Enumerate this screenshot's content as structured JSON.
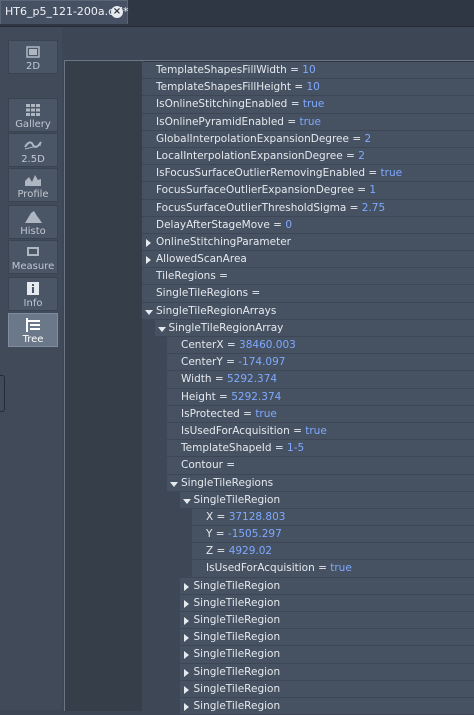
{
  "tab": {
    "title": "HT6_p5_121-200a.czi*"
  },
  "sidebar": {
    "items": [
      {
        "id": "2d",
        "label": "2D",
        "icon": "image-icon",
        "active": false
      },
      {
        "id": "gallery",
        "label": "Gallery",
        "icon": "grid-icon",
        "active": false
      },
      {
        "id": "25d",
        "label": "2.5D",
        "icon": "surface-icon",
        "active": false
      },
      {
        "id": "profile",
        "label": "Profile",
        "icon": "profile-chart-icon",
        "active": false
      },
      {
        "id": "histo",
        "label": "Histo",
        "icon": "histogram-icon",
        "active": false
      },
      {
        "id": "measure",
        "label": "Measure",
        "icon": "measure-icon",
        "active": false
      },
      {
        "id": "info",
        "label": "Info",
        "icon": "info-icon",
        "active": false
      },
      {
        "id": "tree",
        "label": "Tree",
        "icon": "tree-icon",
        "active": true
      }
    ]
  },
  "tree": {
    "rows": [
      {
        "level": 0,
        "toggle": "none",
        "key": "TemplateShapesFillWidth",
        "value": "10"
      },
      {
        "level": 0,
        "toggle": "none",
        "key": "TemplateShapesFillHeight",
        "value": "10"
      },
      {
        "level": 0,
        "toggle": "none",
        "key": "IsOnlineStitchingEnabled",
        "value": "true"
      },
      {
        "level": 0,
        "toggle": "none",
        "key": "IsOnlinePyramidEnabled",
        "value": "true"
      },
      {
        "level": 0,
        "toggle": "none",
        "key": "GlobalInterpolationExpansionDegree",
        "value": "2"
      },
      {
        "level": 0,
        "toggle": "none",
        "key": "LocalInterpolationExpansionDegree",
        "value": "2"
      },
      {
        "level": 0,
        "toggle": "none",
        "key": "IsFocusSurfaceOutlierRemovingEnabled",
        "value": "true"
      },
      {
        "level": 0,
        "toggle": "none",
        "key": "FocusSurfaceOutlierExpansionDegree",
        "value": "1"
      },
      {
        "level": 0,
        "toggle": "none",
        "key": "FocusSurfaceOutlierThresholdSigma",
        "value": "2.75"
      },
      {
        "level": 0,
        "toggle": "none",
        "key": "DelayAfterStageMove",
        "value": "0"
      },
      {
        "level": 0,
        "toggle": "closed",
        "key": "OnlineStitchingParameter",
        "value": null
      },
      {
        "level": 0,
        "toggle": "closed",
        "key": "AllowedScanArea",
        "value": null
      },
      {
        "level": 0,
        "toggle": "none",
        "key": "TileRegions",
        "value": ""
      },
      {
        "level": 0,
        "toggle": "none",
        "key": "SingleTileRegions",
        "value": ""
      },
      {
        "level": 0,
        "toggle": "open",
        "key": "SingleTileRegionArrays",
        "value": null
      },
      {
        "level": 1,
        "toggle": "open",
        "key": "SingleTileRegionArray",
        "value": null
      },
      {
        "level": 2,
        "toggle": "none",
        "key": "CenterX",
        "value": "38460.003"
      },
      {
        "level": 2,
        "toggle": "none",
        "key": "CenterY",
        "value": "-174.097"
      },
      {
        "level": 2,
        "toggle": "none",
        "key": "Width",
        "value": "5292.374"
      },
      {
        "level": 2,
        "toggle": "none",
        "key": "Height",
        "value": "5292.374"
      },
      {
        "level": 2,
        "toggle": "none",
        "key": "IsProtected",
        "value": "true"
      },
      {
        "level": 2,
        "toggle": "none",
        "key": "IsUsedForAcquisition",
        "value": "true"
      },
      {
        "level": 2,
        "toggle": "none",
        "key": "TemplateShapeId",
        "value": "1-5"
      },
      {
        "level": 2,
        "toggle": "none",
        "key": "Contour",
        "value": ""
      },
      {
        "level": 2,
        "toggle": "open",
        "key": "SingleTileRegions",
        "value": null
      },
      {
        "level": 3,
        "toggle": "open",
        "key": "SingleTileRegion",
        "value": null
      },
      {
        "level": 4,
        "toggle": "none",
        "key": "X",
        "value": "37128.803"
      },
      {
        "level": 4,
        "toggle": "none",
        "key": "Y",
        "value": "-1505.297"
      },
      {
        "level": 4,
        "toggle": "none",
        "key": "Z",
        "value": "4929.02"
      },
      {
        "level": 4,
        "toggle": "none",
        "key": "IsUsedForAcquisition",
        "value": "true"
      },
      {
        "level": 3,
        "toggle": "closed",
        "key": "SingleTileRegion",
        "value": null
      },
      {
        "level": 3,
        "toggle": "closed",
        "key": "SingleTileRegion",
        "value": null
      },
      {
        "level": 3,
        "toggle": "closed",
        "key": "SingleTileRegion",
        "value": null
      },
      {
        "level": 3,
        "toggle": "closed",
        "key": "SingleTileRegion",
        "value": null
      },
      {
        "level": 3,
        "toggle": "closed",
        "key": "SingleTileRegion",
        "value": null
      },
      {
        "level": 3,
        "toggle": "closed",
        "key": "SingleTileRegion",
        "value": null
      },
      {
        "level": 3,
        "toggle": "closed",
        "key": "SingleTileRegion",
        "value": null
      },
      {
        "level": 3,
        "toggle": "closed",
        "key": "SingleTileRegion",
        "value": null
      }
    ]
  },
  "colors": {
    "value": "#7fa9ff",
    "row": "#465262",
    "panel": "#2f3640"
  }
}
